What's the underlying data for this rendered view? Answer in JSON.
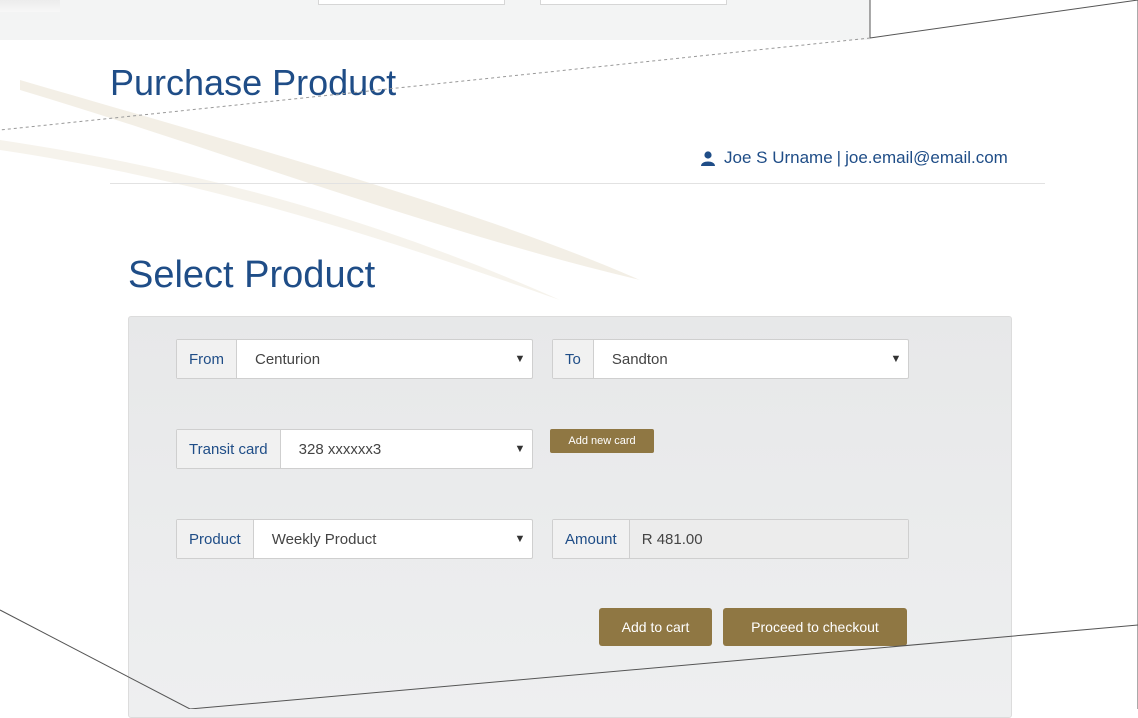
{
  "header": {
    "title": "Purchase Product",
    "user_name": "Joe S Urname",
    "user_sep": "|",
    "user_email": "joe.email@email.com"
  },
  "section": {
    "title": "Select Product"
  },
  "form": {
    "from": {
      "label": "From",
      "value": "Centurion"
    },
    "to": {
      "label": "To",
      "value": "Sandton"
    },
    "transit_card": {
      "label": "Transit card",
      "value": "328 xxxxxx3"
    },
    "add_new_card": "Add new card",
    "product": {
      "label": "Product",
      "value": "Weekly Product"
    },
    "amount": {
      "label": "Amount",
      "value": "R 481.00"
    },
    "add_to_cart": "Add to cart",
    "proceed_to_checkout": "Proceed to checkout",
    "caret_glyph": "▼"
  },
  "colors": {
    "heading": "#1f4d87",
    "button": "#8f7743",
    "panel": "#e9eaeb"
  }
}
